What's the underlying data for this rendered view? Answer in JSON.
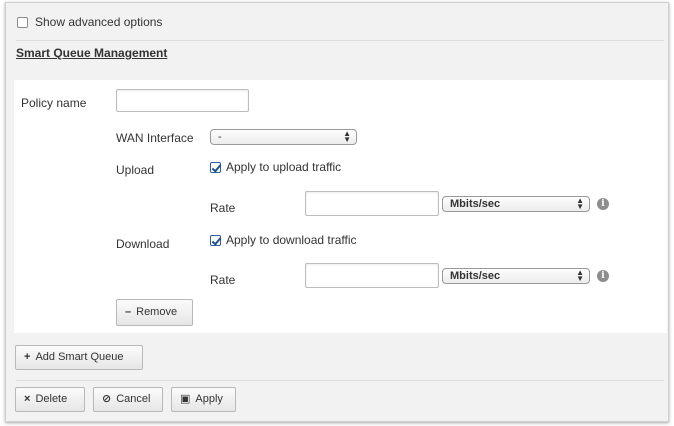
{
  "advanced": {
    "label": "Show advanced options",
    "checked": false
  },
  "section_title": "Smart Queue Management",
  "policy": {
    "label": "Policy name",
    "value": "",
    "wan_label": "WAN Interface",
    "wan_value": "-",
    "upload": {
      "label": "Upload",
      "checkbox_label": "Apply to upload traffic",
      "checked": true,
      "rate_label": "Rate",
      "rate_value": "",
      "unit": "Mbits/sec"
    },
    "download": {
      "label": "Download",
      "checkbox_label": "Apply to download traffic",
      "checked": true,
      "rate_label": "Rate",
      "rate_value": "",
      "unit": "Mbits/sec"
    },
    "remove_label": "Remove",
    "remove_icon": "–"
  },
  "add_label": "Add Smart Queue",
  "add_icon": "+",
  "footer": {
    "delete_label": "Delete",
    "delete_icon": "×",
    "cancel_label": "Cancel",
    "cancel_icon": "⊘",
    "apply_label": "Apply",
    "apply_icon": "▣"
  },
  "info_icon": "i"
}
